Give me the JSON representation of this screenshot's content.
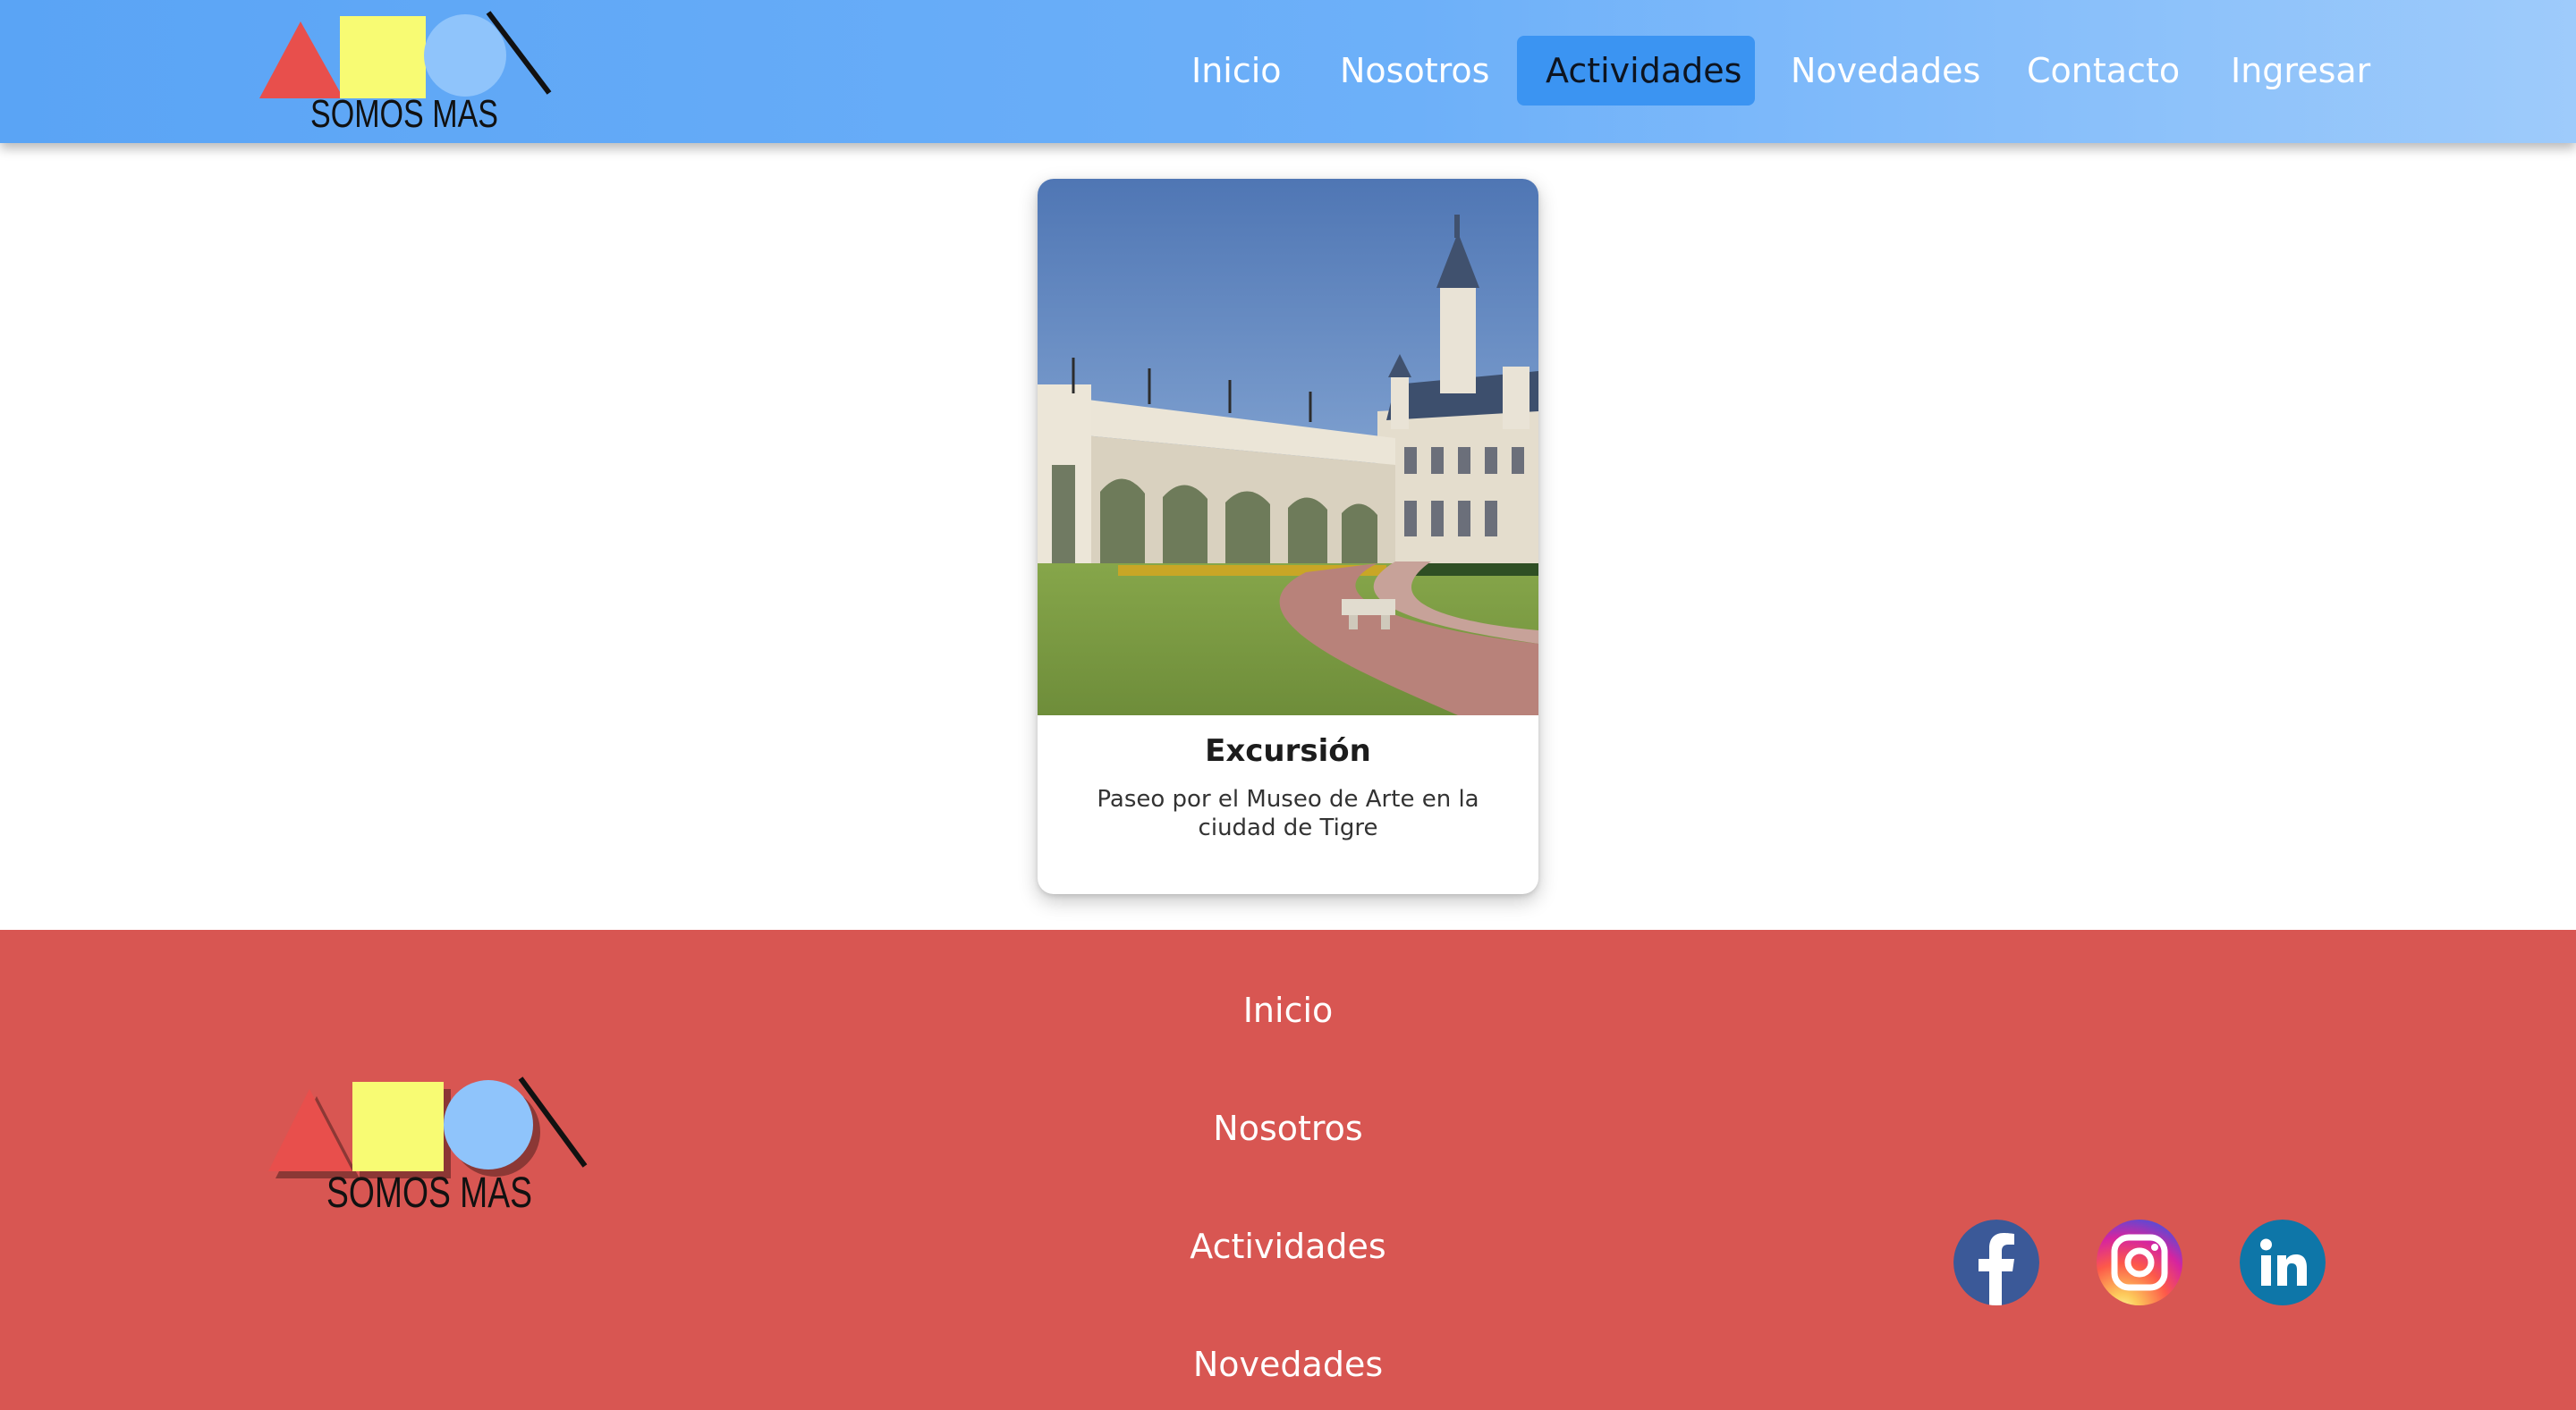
{
  "header": {
    "logo_text": "SOMOS MAS",
    "nav": [
      {
        "label": "Inicio",
        "active": false
      },
      {
        "label": "Nosotros",
        "active": false
      },
      {
        "label": "Actividades",
        "active": true
      },
      {
        "label": "Novedades",
        "active": false
      },
      {
        "label": "Contacto",
        "active": false
      },
      {
        "label": "Ingresar",
        "active": false
      }
    ]
  },
  "activity_card": {
    "title": "Excursión",
    "description": "Paseo por el Museo de Arte en la ciudad de Tigre"
  },
  "footer": {
    "logo_text": "SOMOS MAS",
    "links": [
      "Inicio",
      "Nosotros",
      "Actividades",
      "Novedades"
    ],
    "social": [
      {
        "name": "Facebook",
        "icon": "facebook-icon",
        "color": "#3b5998"
      },
      {
        "name": "Instagram",
        "icon": "instagram-icon",
        "color": "#d6249f"
      },
      {
        "name": "LinkedIn",
        "icon": "linkedin-icon",
        "color": "#0e76a8"
      }
    ]
  },
  "colors": {
    "header_gradient_start": "#5aa4f5",
    "header_gradient_end": "#9ecbfb",
    "nav_active_bg": "#3b94f2",
    "footer_bg": "#d85652",
    "logo_triangle": "#e84f4c",
    "logo_square": "#f8fb73",
    "logo_circle": "#8fc4fb"
  }
}
